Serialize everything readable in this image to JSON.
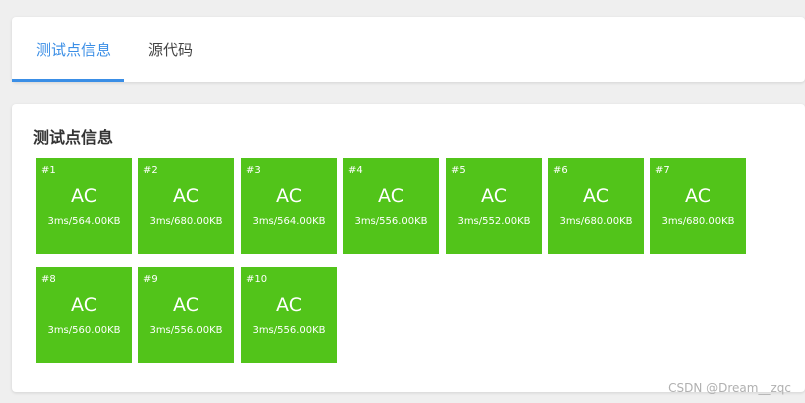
{
  "tabs": [
    {
      "label": "测试点信息",
      "active": true
    },
    {
      "label": "源代码",
      "active": false
    }
  ],
  "section_title": "测试点信息",
  "accent_color": "#3a8ee6",
  "status_color": "#52c41a",
  "test_cases": [
    {
      "num": "#1",
      "status": "AC",
      "detail": "3ms/564.00KB"
    },
    {
      "num": "#2",
      "status": "AC",
      "detail": "3ms/680.00KB"
    },
    {
      "num": "#3",
      "status": "AC",
      "detail": "3ms/564.00KB"
    },
    {
      "num": "#4",
      "status": "AC",
      "detail": "3ms/556.00KB"
    },
    {
      "num": "#5",
      "status": "AC",
      "detail": "3ms/552.00KB"
    },
    {
      "num": "#6",
      "status": "AC",
      "detail": "3ms/680.00KB"
    },
    {
      "num": "#7",
      "status": "AC",
      "detail": "3ms/680.00KB"
    },
    {
      "num": "#8",
      "status": "AC",
      "detail": "3ms/560.00KB"
    },
    {
      "num": "#9",
      "status": "AC",
      "detail": "3ms/556.00KB"
    },
    {
      "num": "#10",
      "status": "AC",
      "detail": "3ms/556.00KB"
    }
  ],
  "watermark": "CSDN @Dream__zqc"
}
